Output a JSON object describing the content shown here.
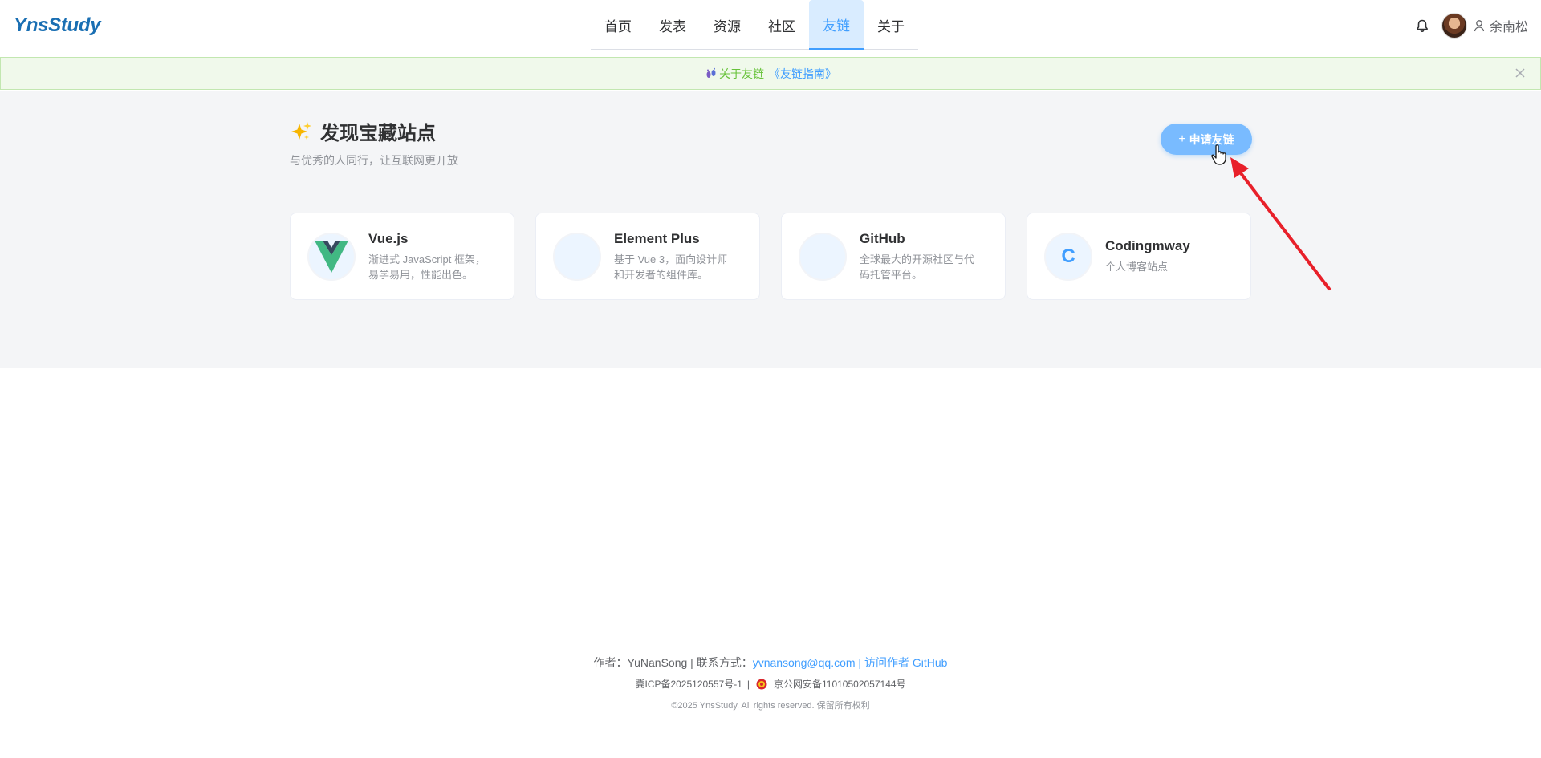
{
  "header": {
    "logo": "YnsStudy",
    "nav": [
      "首页",
      "发表",
      "资源",
      "社区",
      "友链",
      "关于"
    ],
    "active_nav": "友链",
    "username": "余南松"
  },
  "alert": {
    "text": "关于友链",
    "link": "《友链指南》"
  },
  "main": {
    "title": "发现宝藏站点",
    "subtitle": "与优秀的人同行，让互联网更开放",
    "apply_button": "申请友链",
    "cards": [
      {
        "name": "Vue.js",
        "desc": "渐进式 JavaScript 框架，易学易用，性能出色。",
        "logo": ""
      },
      {
        "name": "Element Plus",
        "desc": "基于 Vue 3，面向设计师和开发者的组件库。",
        "logo": ""
      },
      {
        "name": "GitHub",
        "desc": "全球最大的开源社区与代码托管平台。",
        "logo": ""
      },
      {
        "name": "Codingmway",
        "desc": "个人博客站点",
        "logo": "C"
      }
    ]
  },
  "footer": {
    "author_label": "作者：YuNanSong | 联系方式：",
    "email": "yvnansong@qq.com",
    "separator": " | ",
    "github_link": "访问作者 GitHub",
    "icp": "冀ICP备2025120557号-1",
    "icp_sep": "|",
    "police": "京公网安备11010502057144号",
    "copyright": "©2025 YnsStudy. All rights reserved. 保留所有权利"
  },
  "colors": {
    "primary": "#409eff",
    "success": "#67c23a",
    "alert_bg": "#f0f9eb",
    "arrow": "#e8202a"
  }
}
